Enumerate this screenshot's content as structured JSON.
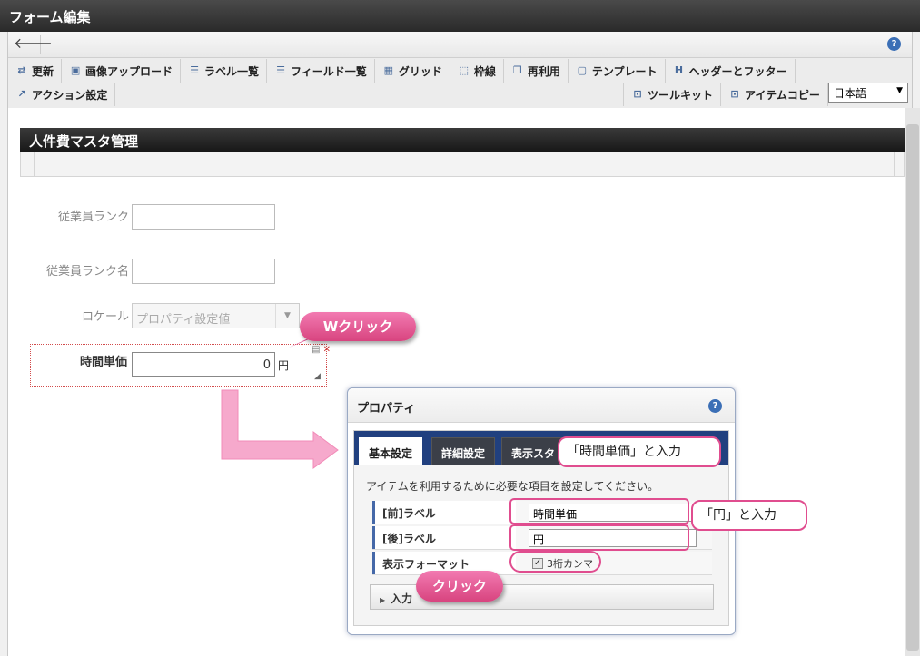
{
  "window": {
    "title": "フォーム編集"
  },
  "toolbar": {
    "row1": [
      {
        "label": "更新",
        "icon": "update-icon",
        "glyph": "⇄"
      },
      {
        "label": "画像アップロード",
        "icon": "image-upload-icon",
        "glyph": "▣"
      },
      {
        "label": "ラベル一覧",
        "icon": "label-list-icon",
        "glyph": "☰"
      },
      {
        "label": "フィールド一覧",
        "icon": "field-list-icon",
        "glyph": "☰"
      },
      {
        "label": "グリッド",
        "icon": "grid-icon",
        "glyph": "▦"
      },
      {
        "label": "枠線",
        "icon": "border-icon",
        "glyph": "⬚"
      },
      {
        "label": "再利用",
        "icon": "reuse-icon",
        "glyph": "❐"
      },
      {
        "label": "テンプレート",
        "icon": "template-icon",
        "glyph": "▢"
      },
      {
        "label": "ヘッダーとフッター",
        "icon": "header-footer-icon",
        "glyph": "H"
      }
    ],
    "action_label": "アクション設定",
    "toolkit_label": "ツールキット",
    "itemcopy_label": "アイテムコピー",
    "language": "日本語"
  },
  "form": {
    "title": "人件費マスタ管理",
    "fields": {
      "rank_label": "従業員ランク",
      "rank_name_label": "従業員ランク名",
      "locale_label": "ロケール",
      "locale_value": "プロパティ設定値",
      "price_label": "時間単価",
      "price_value": "0",
      "price_unit": "円"
    }
  },
  "properties": {
    "title": "プロパティ",
    "tabs": [
      "基本設定",
      "詳細設定",
      "表示スタ"
    ],
    "description": "アイテムを利用するために必要な項目を設定してください。",
    "pre_label_name": "[前]ラベル",
    "pre_label_value": "時間単価",
    "post_label_name": "[後]ラベル",
    "post_label_value": "円",
    "format_name": "表示フォーマット",
    "format_option": "3桁カンマ",
    "input_section": "入力"
  },
  "annotations": {
    "double_click": "Wクリック",
    "enter_price": "「時間単価」と入力",
    "enter_yen": "「円」と入力",
    "click": "クリック"
  },
  "colors": {
    "accent_pink": "#e04d8f",
    "tab_blue": "#21407f"
  }
}
